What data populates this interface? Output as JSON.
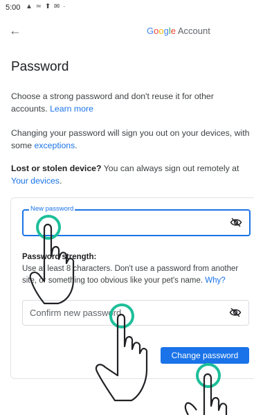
{
  "status_bar": {
    "time": "5:00",
    "icons": "▲ ≃ ⬆ ✉ ·"
  },
  "header": {
    "back_icon": "arrow-back-icon",
    "brand_google": "Google",
    "brand_account": " Account"
  },
  "page": {
    "title": "Password"
  },
  "intro": {
    "p1_text": "Choose a strong password and don't reuse it for other accounts. ",
    "p1_link": "Learn more",
    "p2_text": "Changing your password will sign you out on your devices, with some ",
    "p2_link": "exceptions",
    "p2_end": ".",
    "p3_bold": "Lost or stolen device?",
    "p3_text": " You can always sign out remotely at ",
    "p3_link": "Your devices",
    "p3_end": "."
  },
  "form": {
    "new_password_label": "New password",
    "strength_title": "Password strength:",
    "strength_text": "Use at least 8 characters. Don't use a password from another site, or something too obvious like your pet's name. ",
    "strength_link": "Why?",
    "confirm_placeholder": "Confirm new password",
    "submit_label": "Change password"
  },
  "colors": {
    "accent": "#1a73e8",
    "gesture_ring": "#1dbf9a"
  }
}
